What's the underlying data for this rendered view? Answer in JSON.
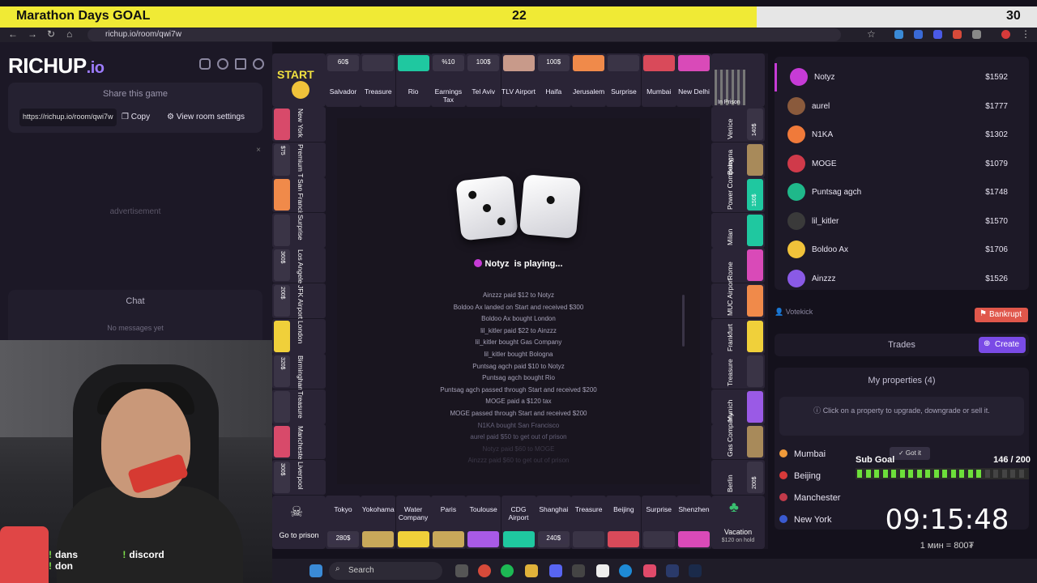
{
  "overlay": {
    "goal_label": "Marathon Days GOAL",
    "goal_current": "22",
    "goal_target": "30",
    "sub_goal_label": "Sub Goal",
    "sub_goal_count": "146 / 200",
    "timer": "09:15:48",
    "rate": "1 мин = 800₮",
    "chat_tags": [
      "dans",
      "discord",
      "don"
    ]
  },
  "browser": {
    "url": "richup.io/room/qwi7w"
  },
  "app": {
    "logo_main": "RICHUP",
    "logo_suffix": ".io",
    "share_title": "Share this game",
    "share_url": "https://richup.io/room/qwi7w",
    "copy_label": "Copy",
    "room_settings_label": "View room settings",
    "advertisement": "advertisement",
    "chat_title": "Chat",
    "chat_empty": "No messages yet"
  },
  "board": {
    "corners": {
      "start": "START",
      "in_prison": "In Prison",
      "go_to_prison": "Go to prison",
      "vacation": "Vacation",
      "vacation_sub": "$120 on hold"
    },
    "top": [
      {
        "name": "Salvador",
        "price": "60$"
      },
      {
        "name": "Treasure",
        "price": ""
      },
      {
        "name": "Rio",
        "price": ""
      },
      {
        "name": "Earnings Tax",
        "price": "%10"
      },
      {
        "name": "Tel Aviv",
        "price": "100$"
      },
      {
        "name": "TLV Airport",
        "price": ""
      },
      {
        "name": "Haifa",
        "price": "100$"
      },
      {
        "name": "Jerusalem",
        "price": ""
      },
      {
        "name": "Surprise",
        "price": ""
      },
      {
        "name": "Mumbai",
        "price": ""
      },
      {
        "name": "New Delhi",
        "price": ""
      }
    ],
    "left": [
      {
        "name": "New York",
        "price": ""
      },
      {
        "name": "Premium Tax",
        "price": "$75"
      },
      {
        "name": "San Francisco",
        "price": ""
      },
      {
        "name": "Surprise",
        "price": ""
      },
      {
        "name": "Los Angeles",
        "price": "360$"
      },
      {
        "name": "JFK Airport",
        "price": "200$"
      },
      {
        "name": "London",
        "price": ""
      },
      {
        "name": "Birmingham",
        "price": "320$"
      },
      {
        "name": "Treasure",
        "price": ""
      },
      {
        "name": "Manchester",
        "price": ""
      },
      {
        "name": "Liverpool",
        "price": "300$"
      }
    ],
    "right": [
      {
        "name": "Venice",
        "price": "140$"
      },
      {
        "name": "Bologna",
        "price": ""
      },
      {
        "name": "Power Company",
        "price": "150$"
      },
      {
        "name": "Milan",
        "price": ""
      },
      {
        "name": "Rome",
        "price": ""
      },
      {
        "name": "MUC Airport",
        "price": ""
      },
      {
        "name": "Frankfurt",
        "price": ""
      },
      {
        "name": "Treasure",
        "price": ""
      },
      {
        "name": "Munich",
        "price": ""
      },
      {
        "name": "Gas Company",
        "price": ""
      },
      {
        "name": "Berlin",
        "price": "200$"
      }
    ],
    "bottom": [
      {
        "name": "Tokyo",
        "price": "280$"
      },
      {
        "name": "Yokohama",
        "price": ""
      },
      {
        "name": "Water Company",
        "price": ""
      },
      {
        "name": "Paris",
        "price": ""
      },
      {
        "name": "Toulouse",
        "price": ""
      },
      {
        "name": "CDG Airport",
        "price": ""
      },
      {
        "name": "Shanghai",
        "price": "240$"
      },
      {
        "name": "Treasure",
        "price": ""
      },
      {
        "name": "Beijing",
        "price": ""
      },
      {
        "name": "Surprise",
        "price": ""
      },
      {
        "name": "Shenzhen",
        "price": ""
      }
    ],
    "dice": [
      3,
      1
    ],
    "playing_name": "Notyz",
    "playing_suffix": "is playing...",
    "log": [
      "Ainzzz  paid $12 to  Notyz",
      "Boldoo Ax  landed on Start and received $300",
      "Boldoo Ax  bought  London",
      "lil_kitler  paid $22 to  Ainzzz",
      "lil_kitler  bought  Gas Company",
      "lil_kitler  bought  Bologna",
      "Puntsag agch  paid $10 to  Notyz",
      "Puntsag agch  bought  Rio",
      "Puntsag agch  passed through Start and received $200",
      "MOGE  paid a $120 tax",
      "MOGE  passed through Start and received $200",
      "N1KA  bought  San Francisco",
      "aurel  paid $50 to get out of prison",
      "Notyz  paid $60 to  MOGE",
      "Ainzzz  paid $60 to get out of prison"
    ]
  },
  "players": [
    {
      "name": "Notyz",
      "money": "$1592",
      "color": "#c63bd6"
    },
    {
      "name": "aurel",
      "money": "$1777",
      "color": "#8a5a3c"
    },
    {
      "name": "N1KA",
      "money": "$1302",
      "color": "#f07a3a"
    },
    {
      "name": "MOGE",
      "money": "$1079",
      "color": "#d03a4a"
    },
    {
      "name": "Puntsag agch",
      "money": "$1748",
      "color": "#1fb88a"
    },
    {
      "name": "lil_kitler",
      "money": "$1570",
      "color": "#3a3a3a"
    },
    {
      "name": "Boldoo Ax",
      "money": "$1706",
      "color": "#f0c23a"
    },
    {
      "name": "Ainzzz",
      "money": "$1526",
      "color": "#8a5ae6"
    }
  ],
  "actions": {
    "votekick": "Votekick",
    "bankrupt": "Bankrupt",
    "trades": "Trades",
    "create": "Create",
    "my_properties": "My properties (4)",
    "hint": "Click on a property to upgrade, downgrade or sell it.",
    "got_it": "Got it"
  },
  "my_properties": [
    {
      "name": "Mumbai",
      "color": "#f09a3a"
    },
    {
      "name": "Beijing",
      "color": "#d83a3a"
    },
    {
      "name": "Manchester",
      "color": "#c23a4a"
    },
    {
      "name": "New York",
      "color": "#3a5ad0"
    }
  ],
  "taskbar": {
    "search_placeholder": "Search"
  }
}
